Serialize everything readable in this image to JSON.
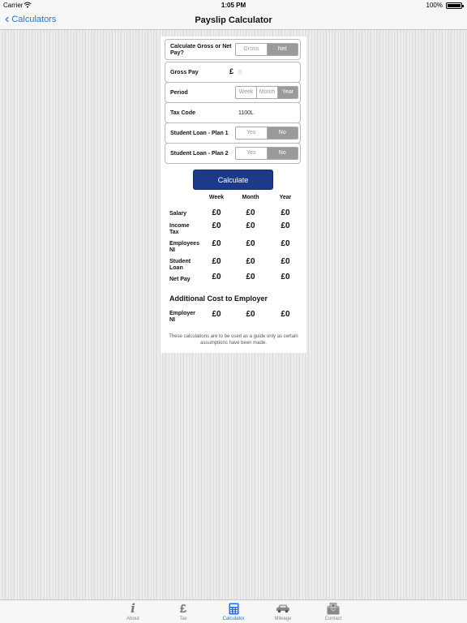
{
  "status": {
    "carrier": "Carrier",
    "time": "1:05 PM",
    "battery": "100%"
  },
  "nav": {
    "back_label": "Calculators",
    "title": "Payslip Calculator"
  },
  "form": {
    "gross_net": {
      "label": "Calculate Gross or Net Pay?",
      "options": [
        "Gross",
        "Net"
      ],
      "selected": "Net"
    },
    "gross_pay": {
      "label": "Gross Pay",
      "currency": "£",
      "placeholder": "0"
    },
    "period": {
      "label": "Period",
      "options": [
        "Week",
        "Month",
        "Year"
      ],
      "selected": "Year"
    },
    "tax_code": {
      "label": "Tax Code",
      "value": "1100L"
    },
    "loan1": {
      "label": "Student Loan - Plan 1",
      "options": [
        "Yes",
        "No"
      ],
      "selected": "No"
    },
    "loan2": {
      "label": "Student Loan - Plan 2",
      "options": [
        "Yes",
        "No"
      ],
      "selected": "No"
    }
  },
  "calculate_label": "Calculate",
  "results": {
    "columns": [
      "Week",
      "Month",
      "Year"
    ],
    "rows": [
      {
        "label": "Salary",
        "values": [
          "£0",
          "£0",
          "£0"
        ]
      },
      {
        "label": "Income Tax",
        "values": [
          "£0",
          "£0",
          "£0"
        ]
      },
      {
        "label": "Employees NI",
        "values": [
          "£0",
          "£0",
          "£0"
        ]
      },
      {
        "label": "Student Loan",
        "values": [
          "£0",
          "£0",
          "£0"
        ]
      },
      {
        "label": "Net Pay",
        "values": [
          "£0",
          "£0",
          "£0"
        ]
      }
    ],
    "additional_title": "Additional Cost to Employer",
    "employer_ni": {
      "label": "Employer NI",
      "values": [
        "£0",
        "£0",
        "£0"
      ]
    },
    "disclaimer": "These calculations are to be used as a guide only as certain assumptions have been made."
  },
  "tabs": [
    {
      "label": "About",
      "icon": "info-icon"
    },
    {
      "label": "Tax",
      "icon": "pound-icon"
    },
    {
      "label": "Calculator",
      "icon": "calculator-icon",
      "active": true
    },
    {
      "label": "Mileage",
      "icon": "car-icon"
    },
    {
      "label": "Contact",
      "icon": "envelope-icon"
    }
  ]
}
